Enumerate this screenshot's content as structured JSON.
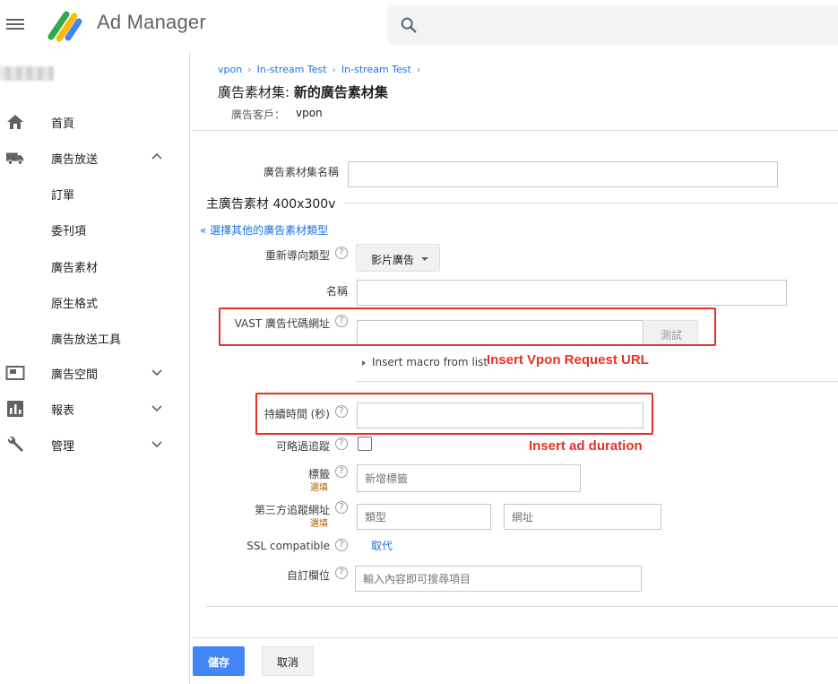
{
  "header": {
    "app_title": "Ad Manager",
    "menu_icon": "menu-icon",
    "search_icon": "search-icon"
  },
  "sidebar": {
    "items": [
      {
        "label": "首頁",
        "icon": "home-icon"
      },
      {
        "label": "廣告放送",
        "icon": "truck-icon",
        "expanded": true,
        "children": [
          "訂單",
          "委刊項",
          "廣告素材",
          "原生格式",
          "廣告放送工具"
        ]
      },
      {
        "label": "廣告空間",
        "icon": "inventory-icon",
        "expanded": false
      },
      {
        "label": "報表",
        "icon": "bar-chart-icon",
        "expanded": false
      },
      {
        "label": "管理",
        "icon": "wrench-icon",
        "expanded": false
      }
    ]
  },
  "breadcrumb": [
    "vpon",
    "In-stream Test",
    "In-stream Test"
  ],
  "page": {
    "title_prefix": "廣告素材集: ",
    "title_main": "新的廣告素材集",
    "advertiser_label": "廣告客戶：",
    "advertiser_value": "vpon"
  },
  "form": {
    "set_name_label": "廣告素材集名稱",
    "set_name_value": "",
    "section_title": "主廣告素材 400x300v",
    "other_type_link": "« 選擇其他的廣告素材類型",
    "redirect_type_label": "重新導向類型",
    "redirect_type_value": "影片廣告",
    "name_label": "名稱",
    "name_value": "",
    "vast_label": "VAST 廣告代碼網址",
    "vast_value": "",
    "test_button": "測試",
    "macro_link": "Insert macro from list",
    "duration_label": "持續時間 (秒)",
    "duration_value": "",
    "skip_label": "可略過追蹤",
    "skip_checked": false,
    "labels_label": "標籤",
    "optional": "選填",
    "labels_placeholder": "新增標籤",
    "third_party_label": "第三方追蹤網址",
    "type_placeholder": "類型",
    "url_placeholder": "網址",
    "ssl_label": "SSL compatible",
    "ssl_link": "取代",
    "custom_fields_label": "自訂欄位",
    "custom_fields_placeholder": "輸入內容即可搜尋項目",
    "help": "?"
  },
  "annotations": {
    "vast_note": "Insert Vpon Request URL",
    "duration_note": "Insert ad duration",
    "color": "#e53223"
  },
  "footer": {
    "save": "儲存",
    "cancel": "取消"
  }
}
